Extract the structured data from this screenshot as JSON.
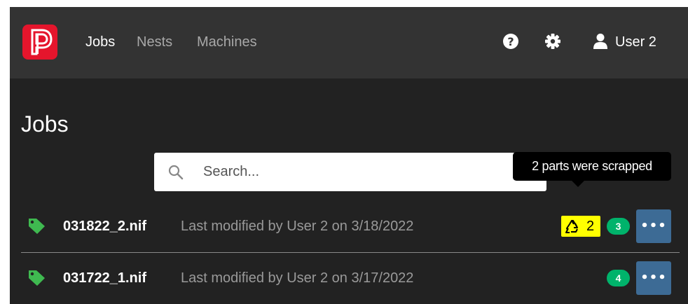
{
  "nav": {
    "links": [
      {
        "label": "Jobs",
        "active": true
      },
      {
        "label": "Nests",
        "active": false
      },
      {
        "label": "Machines",
        "active": false
      }
    ],
    "user_label": "User 2",
    "icons": [
      "logo-icon",
      "help-icon",
      "gear-icon",
      "user-icon"
    ]
  },
  "page": {
    "title": "Jobs"
  },
  "search": {
    "placeholder": "Search..."
  },
  "tooltip": {
    "text": "2 parts were scrapped"
  },
  "jobs": [
    {
      "name": "031822_2.nif",
      "meta": "Last modified by User 2 on 3/18/2022",
      "scrapped": "2",
      "count": "3",
      "more_label": "•••"
    },
    {
      "name": "031722_1.nif",
      "meta": "Last modified by User 2 on 3/17/2022",
      "count": "4",
      "more_label": "•••"
    }
  ],
  "colors": {
    "brand": "#e5152c",
    "navbar": "#333333",
    "background": "#222222",
    "tag": "#3fb950",
    "count_badge": "#00b36b",
    "scrap_badge": "#ffff00",
    "more_button": "#3d6b95"
  }
}
